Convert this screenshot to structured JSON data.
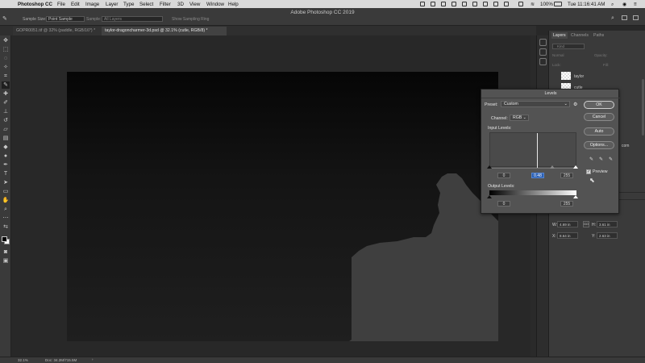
{
  "menubar": {
    "app_name": "Photoshop CC",
    "items": [
      "File",
      "Edit",
      "Image",
      "Layer",
      "Type",
      "Select",
      "Filter",
      "3D",
      "View",
      "Window",
      "Help"
    ],
    "battery": "100%",
    "clock": "Tue 11:16:41 AM"
  },
  "options": {
    "window_title": "Adobe Photoshop CC 2019",
    "sample_size_label": "Sample Size:",
    "sample_size_value": "Point Sample",
    "sample_label": "Sample:",
    "sample_value": "All Layers",
    "show_ring": "Show Sampling Ring"
  },
  "tabs": [
    {
      "label": "GOPR0051.tif @ 32% (paddle, RGB/16*) *"
    },
    {
      "label": "taylor-dragoncharmer-3d.psd @ 32.1% (cutle, RGB/8) *"
    }
  ],
  "panel": {
    "tabs": [
      "Layers",
      "Channels",
      "Paths"
    ],
    "kind_placeholder": "Kind",
    "blend_mode": "Normal",
    "opacity_label": "Opacity:",
    "lock_label": "Lock:",
    "fill_label": "Fill:",
    "layers": [
      {
        "name": "taylor"
      },
      {
        "name": "cutle"
      }
    ],
    "partial_text": "com",
    "properties": {
      "w_label": "W:",
      "w_value": "4.69 in",
      "h_label": "H:",
      "h_value": "3.61 in",
      "x_label": "X:",
      "x_value": "8.64 in",
      "y_label": "Y:",
      "y_value": "2.63 in",
      "link_label": "GO"
    }
  },
  "levels": {
    "title": "Levels",
    "preset_label": "Preset:",
    "preset_value": "Custom",
    "channel_label": "Channel:",
    "channel_value": "RGB",
    "input_label": "Input Levels:",
    "input_black": "0",
    "input_mid": "0.48",
    "input_white": "255",
    "output_label": "Output Levels:",
    "output_black": "0",
    "output_white": "255",
    "ok": "OK",
    "cancel": "Cancel",
    "auto": "Auto",
    "options": "Options...",
    "preview": "Preview",
    "preview_checked": true
  },
  "status": {
    "zoom": "32.1%",
    "doc": "Doc: 34.2M/715.5M"
  },
  "colors": {
    "selection_highlight": "#2a5fb3"
  }
}
